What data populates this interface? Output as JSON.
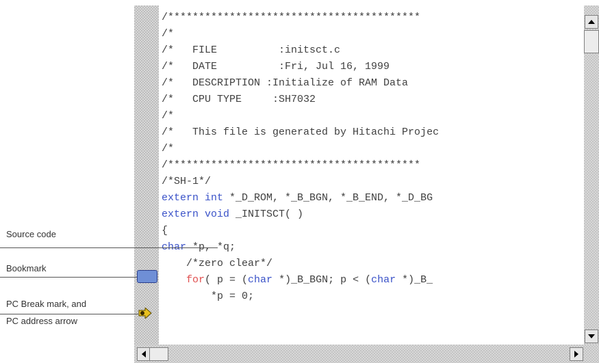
{
  "editor": {
    "code_lines": [
      "/*****************************************",
      "/*",
      "/*   FILE          :initsct.c",
      "/*   DATE          :Fri, Jul 16, 1999",
      "/*   DESCRIPTION :Initialize of RAM Data",
      "/*   CPU TYPE     :SH7032",
      "/*",
      "/*   This file is generated by Hitachi Projec",
      "/*",
      "/*****************************************",
      "/*SH-1*/",
      {
        "kw": "extern int",
        "rest": " *_D_ROM, *_B_BGN, *_B_END, *_D_BG"
      },
      {
        "kw": "extern void",
        "rest": " _INITSCT( )"
      },
      "{",
      {
        "kw": "char",
        "rest": " *p, *q;"
      },
      "    /*zero clear*/",
      {
        "pre": "    ",
        "kw_red": "for",
        "rest1": "( p = (",
        "kw2": "char",
        "rest2": " *)_B_BGN; p < (",
        "kw3": "char",
        "rest3": " *)_B_"
      },
      "        *p = 0;"
    ]
  },
  "annotations": {
    "source_code": "Source code",
    "bookmark": "Bookmark",
    "pc_break_line1": "PC Break mark, and",
    "pc_break_line2": "PC address arrow"
  },
  "icons": {
    "scroll_up": "triangle-up",
    "scroll_down": "triangle-down",
    "scroll_left": "triangle-left",
    "scroll_right": "triangle-right",
    "bookmark": "bookmark-marker",
    "pc_arrow": "pc-break-arrow"
  },
  "colors": {
    "keyword": "#3a52c8",
    "loop_keyword": "#e05050",
    "bookmark": "#6f8fd6",
    "pc_arrow": "#e8c020"
  }
}
